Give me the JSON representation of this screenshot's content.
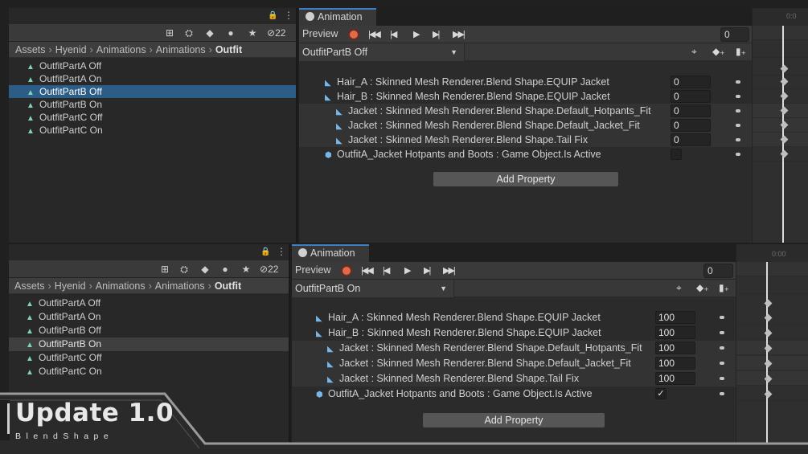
{
  "panels": [
    {
      "project": {
        "hidden_count": "22",
        "breadcrumbs": [
          "Assets",
          "Hyenid",
          "Animations",
          "Animations",
          "Outfit"
        ],
        "items": [
          {
            "label": "OutfitPartA Off",
            "state": ""
          },
          {
            "label": "OutfitPartA On",
            "state": ""
          },
          {
            "label": "OutfitPartB Off",
            "state": "selected"
          },
          {
            "label": "OutfitPartB On",
            "state": ""
          },
          {
            "label": "OutfitPartC Off",
            "state": ""
          },
          {
            "label": "OutfitPartC On",
            "state": ""
          }
        ]
      },
      "animation": {
        "tab_label": "Animation",
        "preview_label": "Preview",
        "frame": "0",
        "clip": "OutfitPartB Off",
        "time_label": "0:0",
        "add_property": "Add Property",
        "properties": [
          {
            "label": "Hair_A : Skinned Mesh Renderer.Blend Shape.EQUIP Jacket",
            "value": "0",
            "indent": 0,
            "kind": "blend"
          },
          {
            "label": "Hair_B : Skinned Mesh Renderer.Blend Shape.EQUIP Jacket",
            "value": "0",
            "indent": 0,
            "kind": "blend"
          },
          {
            "label": "Jacket : Skinned Mesh Renderer.Blend Shape.Default_Hotpants_Fit",
            "value": "0",
            "indent": 1,
            "kind": "blend"
          },
          {
            "label": "Jacket : Skinned Mesh Renderer.Blend Shape.Default_Jacket_Fit",
            "value": "0",
            "indent": 1,
            "kind": "blend"
          },
          {
            "label": "Jacket : Skinned Mesh Renderer.Blend Shape.Tail Fix",
            "value": "0",
            "indent": 1,
            "kind": "blend"
          },
          {
            "label": "OutfitA_Jacket Hotpants and Boots : Game Object.Is Active",
            "value": "",
            "indent": 0,
            "kind": "bool",
            "checked": false
          }
        ]
      }
    },
    {
      "project": {
        "hidden_count": "22",
        "breadcrumbs": [
          "Assets",
          "Hyenid",
          "Animations",
          "Animations",
          "Outfit"
        ],
        "items": [
          {
            "label": "OutfitPartA Off",
            "state": ""
          },
          {
            "label": "OutfitPartA On",
            "state": ""
          },
          {
            "label": "OutfitPartB Off",
            "state": ""
          },
          {
            "label": "OutfitPartB On",
            "state": "highlighted"
          },
          {
            "label": "OutfitPartC Off",
            "state": ""
          },
          {
            "label": "OutfitPartC On",
            "state": ""
          }
        ]
      },
      "animation": {
        "tab_label": "Animation",
        "preview_label": "Preview",
        "frame": "0",
        "clip": "OutfitPartB On",
        "time_label": "0:00",
        "add_property": "Add Property",
        "properties": [
          {
            "label": "Hair_A : Skinned Mesh Renderer.Blend Shape.EQUIP Jacket",
            "value": "100",
            "indent": 0,
            "kind": "blend"
          },
          {
            "label": "Hair_B : Skinned Mesh Renderer.Blend Shape.EQUIP Jacket",
            "value": "100",
            "indent": 0,
            "kind": "blend"
          },
          {
            "label": "Jacket : Skinned Mesh Renderer.Blend Shape.Default_Hotpants_Fit",
            "value": "100",
            "indent": 1,
            "kind": "blend"
          },
          {
            "label": "Jacket : Skinned Mesh Renderer.Blend Shape.Default_Jacket_Fit",
            "value": "100",
            "indent": 1,
            "kind": "blend"
          },
          {
            "label": "Jacket : Skinned Mesh Renderer.Blend Shape.Tail Fix",
            "value": "100",
            "indent": 1,
            "kind": "blend"
          },
          {
            "label": "OutfitA_Jacket Hotpants and Boots : Game Object.Is Active",
            "value": "",
            "indent": 0,
            "kind": "bool",
            "checked": true
          }
        ]
      }
    }
  ],
  "brand": {
    "title": "Update 1.0",
    "subtitle": "BlendShape"
  },
  "colors": {
    "selection": "#2c5d87",
    "record": "#e06a4a",
    "tab_accent": "#3d7fc2"
  }
}
